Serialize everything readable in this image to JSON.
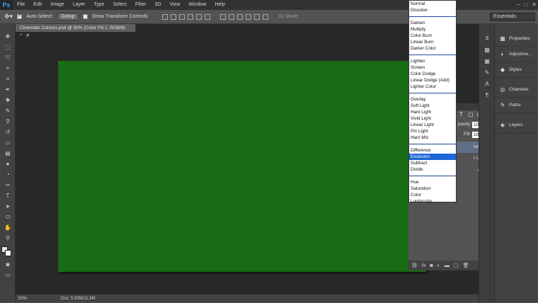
{
  "app": {
    "logo": "Ps"
  },
  "menu": [
    "File",
    "Edit",
    "Image",
    "Layer",
    "Type",
    "Select",
    "Filter",
    "3D",
    "View",
    "Window",
    "Help"
  ],
  "options": {
    "auto_select_label": "Auto-Select:",
    "auto_select_value": "Group",
    "transform_label": "Show Transform Controls",
    "mode_label": "3D Mode:",
    "workspace": "Essentials"
  },
  "document": {
    "tab_title": "Cinematic Colours.psd @ 50% (Color Fill 1, RGB/8) *",
    "zoom": "50%",
    "doc_size": "Doc: 5.93M/11.9M",
    "fill_color": "#1a6b15"
  },
  "panels": [
    {
      "icon": "info-icon",
      "glyph": "▦",
      "label": "Properties"
    },
    {
      "icon": "adjust-icon",
      "glyph": "◐",
      "label": "Adjustme..."
    },
    {
      "icon": "styles-icon",
      "glyph": "◆",
      "label": "Styles"
    },
    {
      "icon": "channels-icon",
      "glyph": "◎",
      "label": "Channels"
    },
    {
      "icon": "paths-icon",
      "glyph": "✎",
      "label": "Paths"
    },
    {
      "icon": "layers-icon",
      "glyph": "◈",
      "label": "Layers"
    }
  ],
  "layers": {
    "opacity_label": "pacity:",
    "opacity": "100%",
    "fill_label": "Fill:",
    "fill": "100%",
    "row1": "lor Fill 1",
    "row2": "t copy"
  },
  "blend_modes": {
    "groups": [
      [
        "Normal",
        "Dissolve"
      ],
      [
        "Darken",
        "Multiply",
        "Color Burn",
        "Linear Burn",
        "Darker Color"
      ],
      [
        "Lighten",
        "Screen",
        "Color Dodge",
        "Linear Dodge (Add)",
        "Lighter Color"
      ],
      [
        "Overlay",
        "Soft Light",
        "Hard Light",
        "Vivid Light",
        "Linear Light",
        "Pin Light",
        "Hard Mix"
      ],
      [
        "Difference",
        "Exclusion",
        "Subtract",
        "Divide"
      ],
      [
        "Hue",
        "Saturation",
        "Color",
        "Luminosity"
      ]
    ],
    "selected": "Exclusion"
  }
}
